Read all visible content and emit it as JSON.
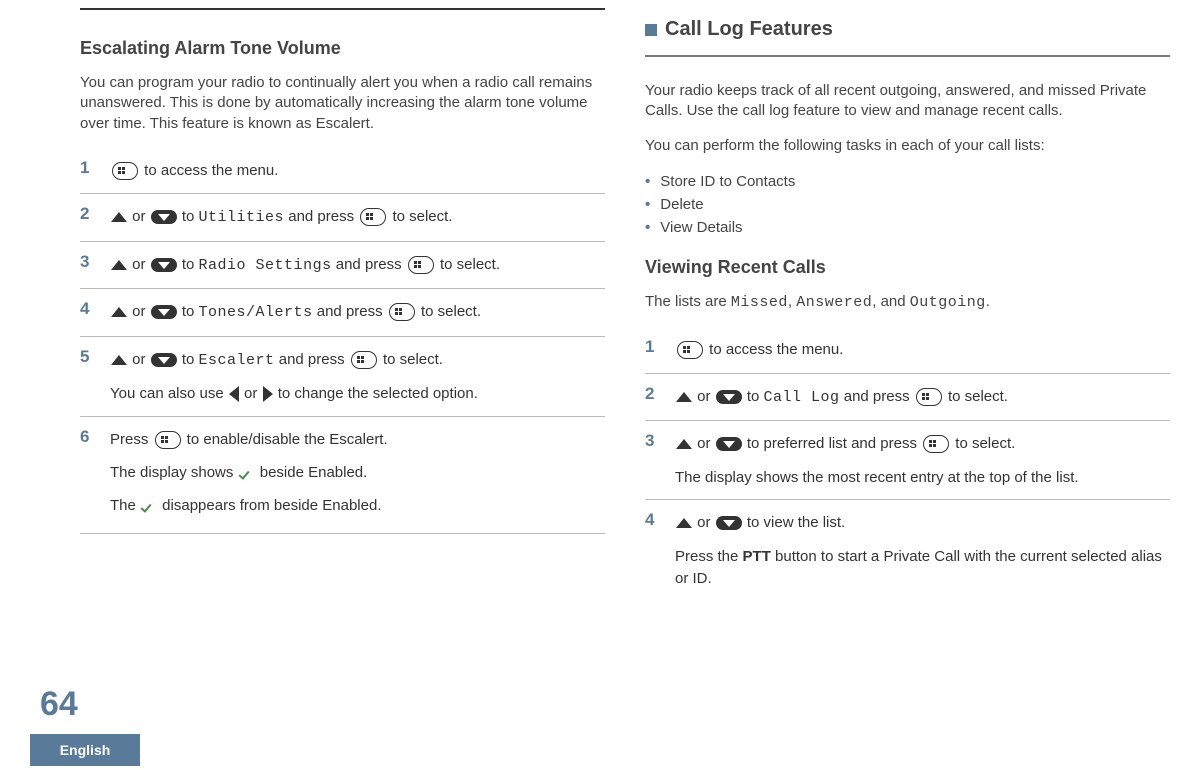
{
  "page_number": "64",
  "language_tab": "English",
  "left": {
    "heading": "Escalating Alarm Tone Volume",
    "intro": "You can program your radio to continually alert you when a radio call remains unanswered. This is done by automatically increasing the alarm tone volume over time. This feature is known as Escalert.",
    "steps": {
      "s1": {
        "num": "1",
        "tail": " to access the menu."
      },
      "s2": {
        "num": "2",
        "or": " or ",
        "to": " to ",
        "menu": "Utilities",
        "mid": " and press ",
        "end": " to select."
      },
      "s3": {
        "num": "3",
        "or": " or ",
        "to": " to ",
        "menu": "Radio Settings",
        "mid": " and press ",
        "end": " to select."
      },
      "s4": {
        "num": "4",
        "or": " or ",
        "to": " to ",
        "menu": "Tones/Alerts",
        "mid": " and press ",
        "end": " to select."
      },
      "s5": {
        "num": "5",
        "or": " or ",
        "to": " to ",
        "menu": "Escalert",
        "mid": " and press ",
        "end": " to select.",
        "aux_a": "You can also use ",
        "aux_mid": " or ",
        "aux_b": " to change the selected option."
      },
      "s6": {
        "num": "6",
        "a": "Press ",
        "b": " to enable/disable the Escalert.",
        "line2a": "The display shows ",
        "line2b": " beside Enabled.",
        "line3a": "The ",
        "line3b": " disappears from beside Enabled."
      }
    }
  },
  "right": {
    "section": "Call Log Features",
    "intro1": "Your radio keeps track of all recent outgoing, answered, and missed Private Calls. Use the call log feature to view and manage recent calls.",
    "intro2": "You can perform the following tasks in each of your call lists:",
    "bullets": [
      "Store ID to Contacts",
      "Delete",
      "View Details"
    ],
    "sub_heading": "Viewing Recent Calls",
    "lists_a": "The lists are ",
    "lists_m1": "Missed",
    "lists_c1": ", ",
    "lists_m2": "Answered",
    "lists_c2": ", and ",
    "lists_m3": "Outgoing",
    "lists_end": ".",
    "steps": {
      "s1": {
        "num": "1",
        "tail": " to access the menu."
      },
      "s2": {
        "num": "2",
        "or": " or ",
        "to": " to ",
        "menu": "Call Log",
        "mid": " and press ",
        "end": " to select."
      },
      "s3": {
        "num": "3",
        "or": " or ",
        "txt": " to preferred list and press ",
        "end": " to select.",
        "aux": "The display shows the most recent entry at the top of the list."
      },
      "s4": {
        "num": "4",
        "or": " or ",
        "txt": " to view the list.",
        "aux_a": "Press the ",
        "aux_bold": "PTT",
        "aux_b": " button to start a Private Call with the current selected alias or ID."
      }
    }
  }
}
